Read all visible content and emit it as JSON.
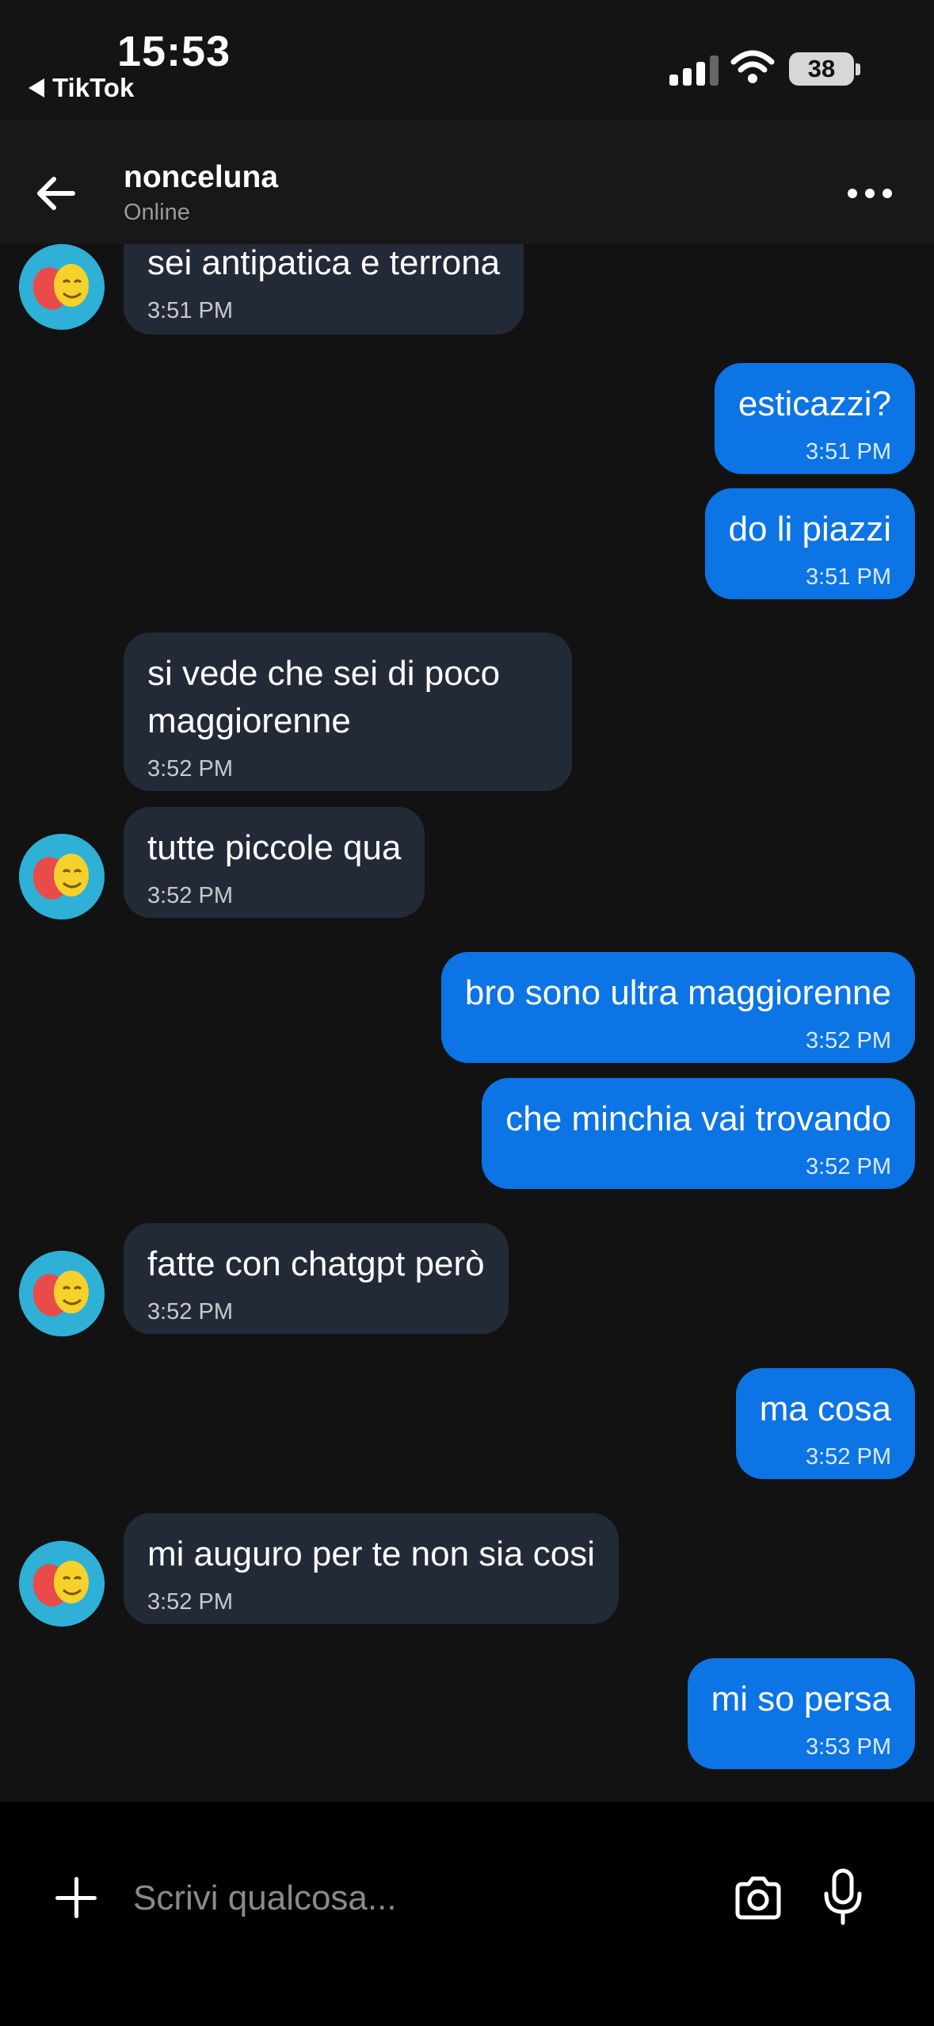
{
  "status_bar": {
    "time": "15:53",
    "back_app": "TikTok",
    "battery": "38"
  },
  "header": {
    "title": "nonceluna",
    "subtitle": "Online"
  },
  "messages": [
    {
      "text": "sei antipatica e terrona",
      "time": "3:51 PM"
    },
    {
      "text": "esticazzi?",
      "time": "3:51 PM"
    },
    {
      "text": "do li piazzi",
      "time": "3:51 PM"
    },
    {
      "text_line1": "si vede che sei di poco",
      "text_line2": "maggiorenne",
      "time": "3:52 PM"
    },
    {
      "text": "tutte piccole qua",
      "time": "3:52 PM"
    },
    {
      "text": "bro sono ultra maggiorenne",
      "time": "3:52 PM"
    },
    {
      "text": "che minchia vai trovando",
      "time": "3:52 PM"
    },
    {
      "text": "fatte con chatgpt però",
      "time": "3:52 PM"
    },
    {
      "text": "ma cosa",
      "time": "3:52 PM"
    },
    {
      "text": "mi auguro per te non sia cosi",
      "time": "3:52 PM"
    },
    {
      "text": "mi so persa",
      "time": "3:53 PM"
    }
  ],
  "composer": {
    "placeholder": "Scrivi qualcosa..."
  },
  "colors": {
    "incoming_bubble": "#232a37",
    "outgoing_bubble": "#0c74e4",
    "avatar_bg": "#2fb0d6"
  },
  "icons": [
    "back-arrow-icon",
    "more-icon",
    "plus-icon",
    "camera-icon",
    "microphone-icon",
    "theater-masks-icon",
    "signal-icon",
    "wifi-icon",
    "battery-icon"
  ]
}
